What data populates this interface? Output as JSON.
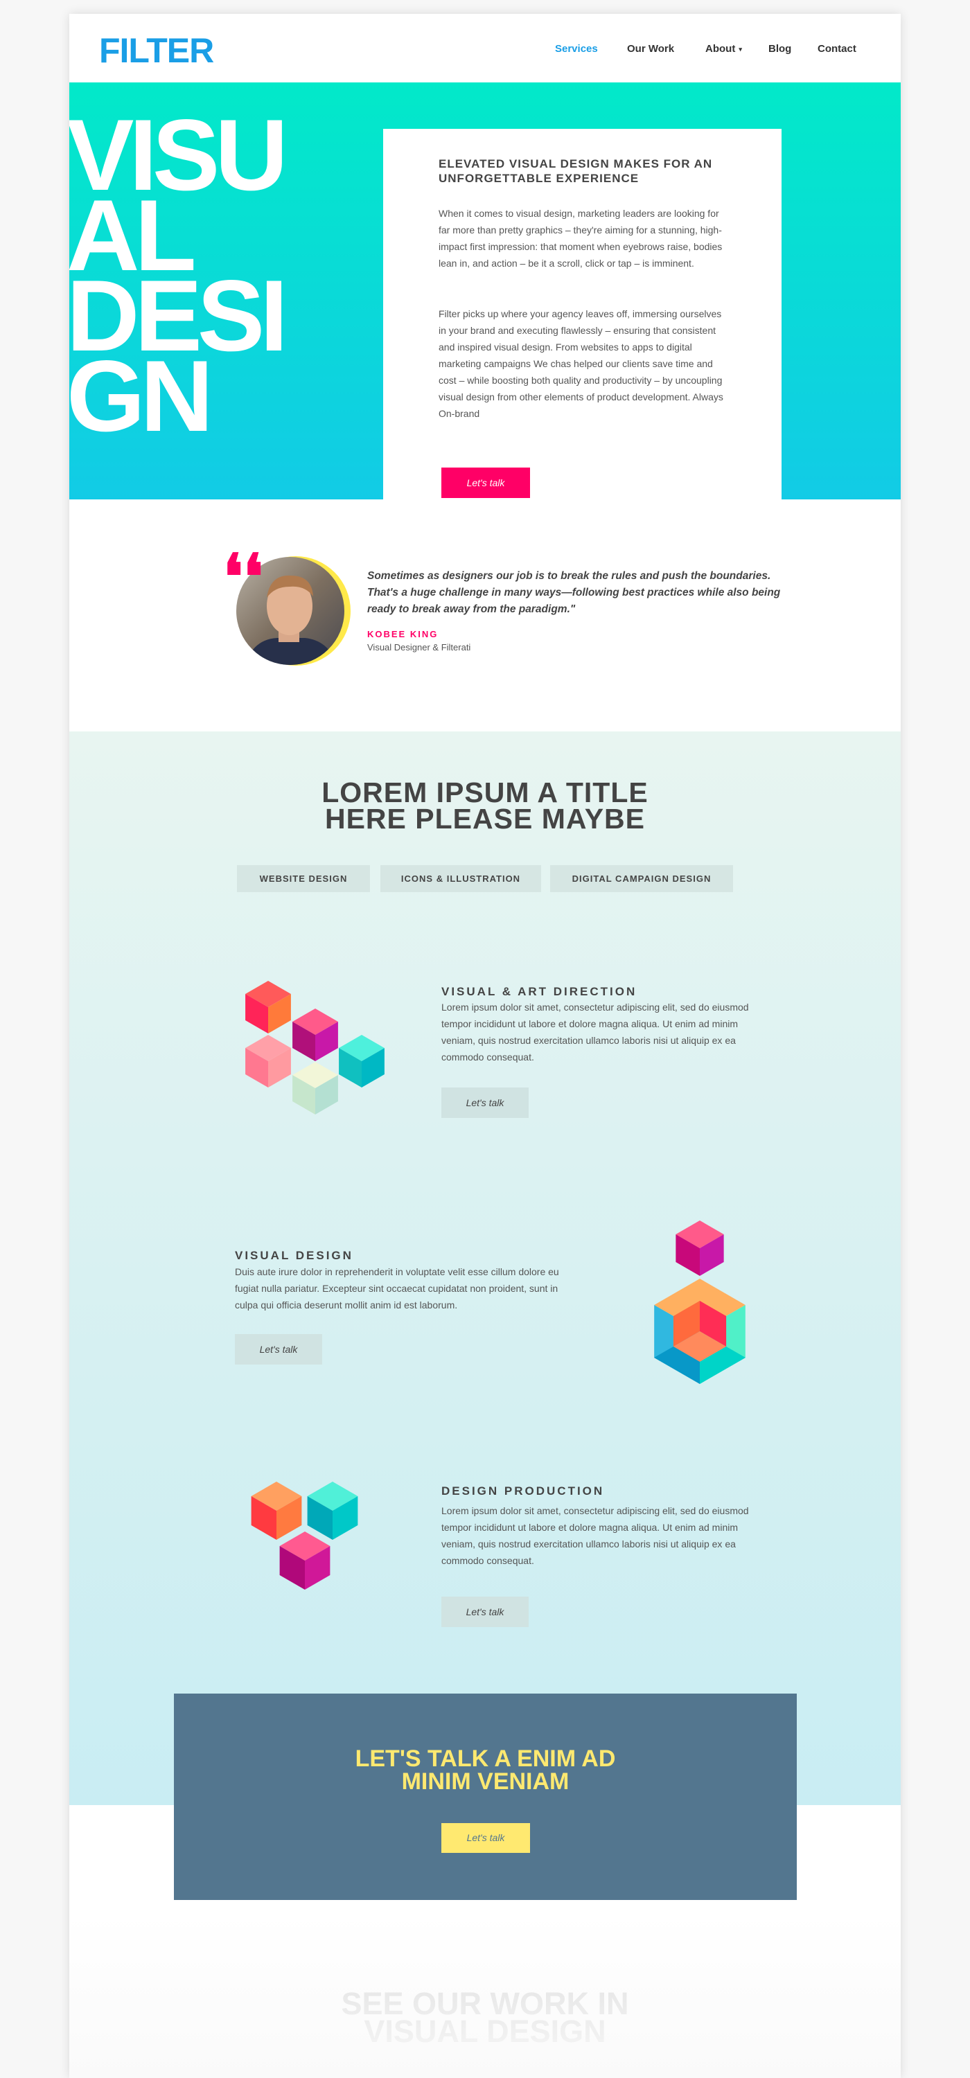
{
  "brand": {
    "logo": "FILTER",
    "accent": "#1a9ee6",
    "pink": "#ff0066",
    "yellow": "#ffe970",
    "slate": "#53768f"
  },
  "nav": {
    "items": [
      {
        "label": "Services",
        "active": true
      },
      {
        "label": "Our Work"
      },
      {
        "label": "About",
        "has_dropdown": true
      },
      {
        "label": "Blog"
      },
      {
        "label": "Contact"
      }
    ],
    "caret": "▾"
  },
  "hero": {
    "big_word": "VISU\nAL\nDESI\nGN",
    "heading": "ELEVATED VISUAL DESIGN MAKES FOR AN UNFORGETTABLE EXPERIENCE",
    "para1": "When it comes to visual design, marketing leaders are looking for far more than pretty graphics – they're aiming for a stunning, high-impact first impression: that moment when eyebrows raise, bodies lean in, and action – be it a scroll, click or tap – is imminent.",
    "para2": "Filter picks up where your agency leaves off, immersing ourselves in your brand and executing flawlessly – ensuring that consistent and inspired visual design. From websites to apps to digital marketing campaigns We chas helped our clients save time and cost – while boosting both quality and productivity – by uncoupling visual design from other elements of product development. Always On-brand",
    "cta": "Let's talk"
  },
  "testimonial": {
    "quote_mark": "❛❛",
    "quote": "Sometimes as designers our job is to break the rules and push the boundaries. That's a huge challenge in many ways—following best practices while also being ready to break away from the paradigm.\"",
    "name": "KOBEE KING",
    "title": "Visual Designer & Filterati"
  },
  "services": {
    "title": "LOREM IPSUM A TITLE HERE PLEASE MAYBE",
    "tabs": [
      "WEBSITE DESIGN",
      "ICONS & ILLUSTRATION",
      "DIGITAL CAMPAIGN DESIGN"
    ],
    "rows": [
      {
        "heading": "VISUAL & ART DIRECTION",
        "text": "Lorem ipsum dolor sit amet, consectetur adipiscing elit, sed do eiusmod tempor incididunt ut labore et dolore magna aliqua. Ut enim ad minim veniam, quis nostrud exercitation ullamco laboris nisi ut aliquip ex ea commodo consequat.",
        "button": "Let's talk",
        "icon": "cubes-cluster-icon"
      },
      {
        "heading": "VISUAL DESIGN",
        "text": "Duis aute irure dolor in reprehenderit in voluptate velit esse cillum dolore eu fugiat nulla pariatur. Excepteur sint occaecat cupidatat non proident, sunt in culpa qui officia deserunt mollit anim id est laborum.",
        "button": "Let's talk",
        "icon": "hollow-cube-icon"
      },
      {
        "heading": "DESIGN PRODUCTION",
        "text": "Lorem ipsum dolor sit amet, consectetur adipiscing elit, sed do eiusmod tempor incididunt ut labore et dolore magna aliqua. Ut enim ad minim veniam, quis nostrud exercitation ullamco laboris nisi ut aliquip ex ea commodo consequat.",
        "button": "Let's talk",
        "icon": "three-cubes-icon"
      }
    ]
  },
  "cta": {
    "title_line1": "LET'S TALK A ENIM AD",
    "title_line2": "MINIM VENIAM",
    "button": "Let's talk"
  },
  "work": {
    "title_line1": "SEE OUR WORK IN",
    "title_line2": "VISUAL DESIGN"
  }
}
